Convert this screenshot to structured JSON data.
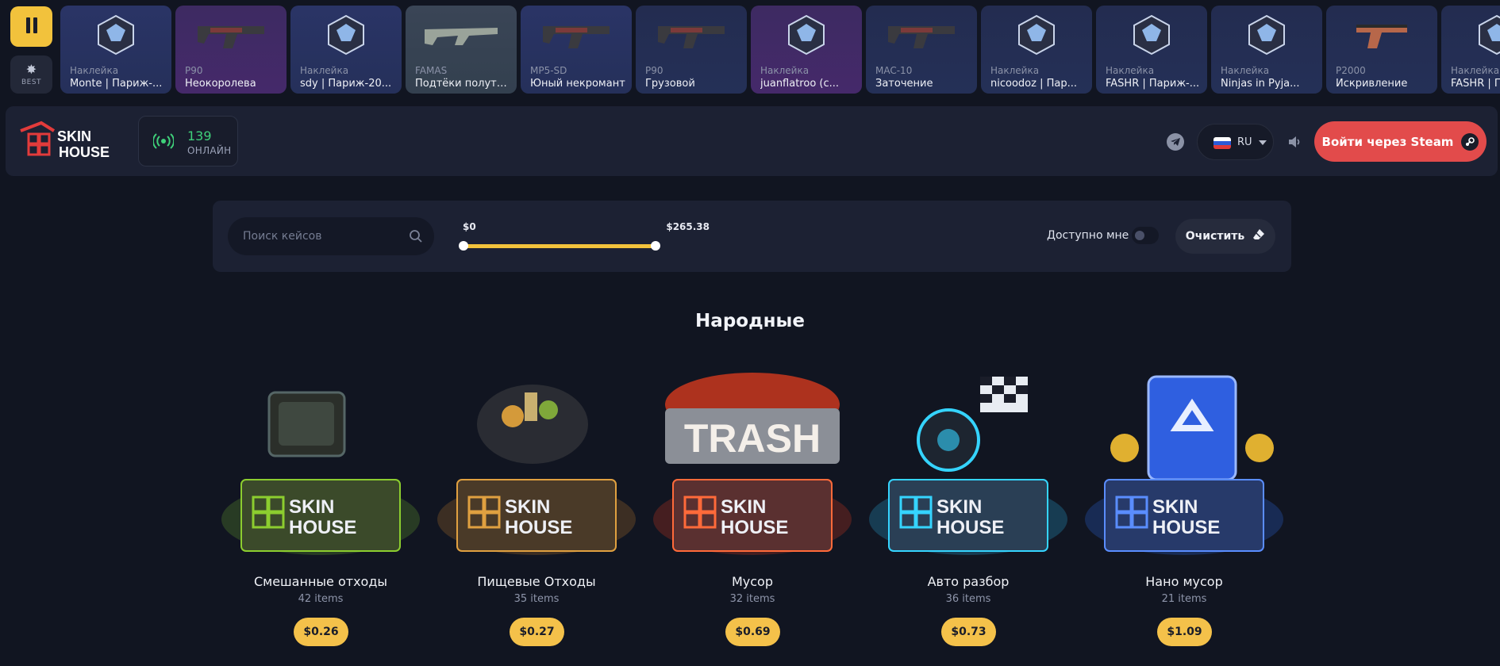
{
  "live_drops": {
    "pause_icon": "pause-icon",
    "best_label": "BEST",
    "items": [
      {
        "type": "Наклейка",
        "name": "Monte | Париж-...",
        "rarity": "blue",
        "icon": "trident-sticker-icon"
      },
      {
        "type": "P90",
        "name": "Неокоролева",
        "rarity": "purple",
        "icon": "smg-icon"
      },
      {
        "type": "Наклейка",
        "name": "sdy | Париж-20...",
        "rarity": "blue",
        "icon": "sdy-sticker-icon"
      },
      {
        "type": "FAMAS",
        "name": "Подтёки полуто...",
        "rarity": "gray",
        "icon": "rifle-icon"
      },
      {
        "type": "MP5-SD",
        "name": "Юный некромант",
        "rarity": "blue",
        "icon": "smg-icon"
      },
      {
        "type": "P90",
        "name": "Грузовой",
        "rarity": "navy",
        "icon": "smg-icon"
      },
      {
        "type": "Наклейка",
        "name": "juanflatroo (с...",
        "rarity": "purple",
        "icon": "signature-sticker-icon"
      },
      {
        "type": "MAC-10",
        "name": "Заточение",
        "rarity": "navy",
        "icon": "smg-icon"
      },
      {
        "type": "Наклейка",
        "name": "nicoodoz | Пар...",
        "rarity": "navy",
        "icon": "signature-sticker-icon"
      },
      {
        "type": "Наклейка",
        "name": "FASHR | Париж-...",
        "rarity": "navy",
        "icon": "fashr-sticker-icon"
      },
      {
        "type": "Наклейка",
        "name": "Ninjas in Pyja...",
        "rarity": "navy",
        "icon": "nip-sticker-icon"
      },
      {
        "type": "P2000",
        "name": "Искривление",
        "rarity": "navy",
        "icon": "pistol-icon"
      },
      {
        "type": "Наклейка",
        "name": "FASHR | П",
        "rarity": "navy",
        "icon": "fashr-sticker-icon"
      }
    ]
  },
  "header": {
    "logo_line1": "SKIN",
    "logo_line2": "HOUSE",
    "online_count": "139",
    "online_label": "ОНЛАЙН",
    "language": "RU",
    "login_button": "Войти через Steam"
  },
  "filters": {
    "search_placeholder": "Поиск кейсов",
    "price_min": "$0",
    "price_max": "$265.38",
    "available_label": "Доступно мне",
    "available_on": false,
    "clear_button": "Очистить"
  },
  "section": {
    "title": "Народные",
    "cases": [
      {
        "name": "Смешанные отходы",
        "count": "42 items",
        "price": "$0.26",
        "theme": "green",
        "art": "tv-trash-case"
      },
      {
        "name": "Пищевые Отходы",
        "count": "35 items",
        "price": "$0.27",
        "theme": "orange",
        "art": "food-trash-case"
      },
      {
        "name": "Мусор",
        "count": "32 items",
        "price": "$0.69",
        "theme": "red",
        "art": "trash-case",
        "art_text": "TRASH"
      },
      {
        "name": "Авто разбор",
        "count": "36 items",
        "price": "$0.73",
        "theme": "cyan",
        "art": "tires-flag-case"
      },
      {
        "name": "Нано мусор",
        "count": "21 items",
        "price": "$1.09",
        "theme": "blue",
        "art": "recycle-case"
      }
    ]
  },
  "colors": {
    "background": "#111521",
    "panel": "#1c2133",
    "accent_yellow": "#f2c23c",
    "steam_red": "#e24b4b",
    "online_green": "#3fd07a"
  }
}
